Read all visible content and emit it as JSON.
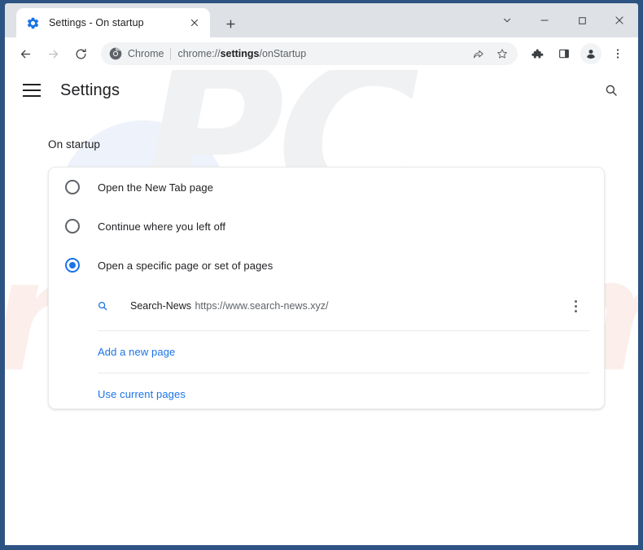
{
  "window": {
    "border_color": "#2d5382",
    "controls": [
      {
        "name": "tab-search",
        "glyph": "chevron-down"
      },
      {
        "name": "minimize",
        "glyph": "minimize"
      },
      {
        "name": "maximize",
        "glyph": "maximize"
      },
      {
        "name": "close",
        "glyph": "close"
      }
    ]
  },
  "tabstrip": {
    "tab": {
      "title": "Settings - On startup",
      "favicon": "settings-gear-icon",
      "close_label": "×"
    },
    "new_tab_label": "+"
  },
  "toolbar": {
    "back_icon": "back-arrow-icon",
    "forward_icon": "forward-arrow-icon",
    "reload_icon": "reload-icon",
    "omnibox": {
      "chip_icon": "chrome-logo-icon",
      "chip_label": "Chrome",
      "url_prefix": "chrome://",
      "url_bold": "settings",
      "url_suffix": "/onStartup",
      "full_url": "chrome://settings/onStartup",
      "share_icon": "share-icon",
      "bookmark_icon": "star-icon"
    },
    "extensions_icon": "puzzle-piece-icon",
    "side_panel_icon": "side-panel-icon",
    "profile_icon": "account-avatar-icon",
    "menu_icon": "three-dot-menu-icon"
  },
  "settings_page": {
    "menu_icon": "hamburger-menu-icon",
    "title": "Settings",
    "search_icon": "search-icon",
    "section_heading": "On startup",
    "options": [
      {
        "label": "Open the New Tab page",
        "selected": false
      },
      {
        "label": "Continue where you left off",
        "selected": false
      },
      {
        "label": "Open a specific page or set of pages",
        "selected": true
      }
    ],
    "startup_pages": [
      {
        "favicon": "search-magnifier-icon",
        "name": "Search-News",
        "url": "https://www.search-news.xyz/",
        "menu_icon": "three-dot-menu-icon"
      }
    ],
    "links": [
      {
        "label": "Add a new page"
      },
      {
        "label": "Use current pages"
      }
    ],
    "accent_color": "#1a73e8"
  },
  "watermark": {
    "text_top": "PC",
    "text_bottom": "risk.com"
  }
}
